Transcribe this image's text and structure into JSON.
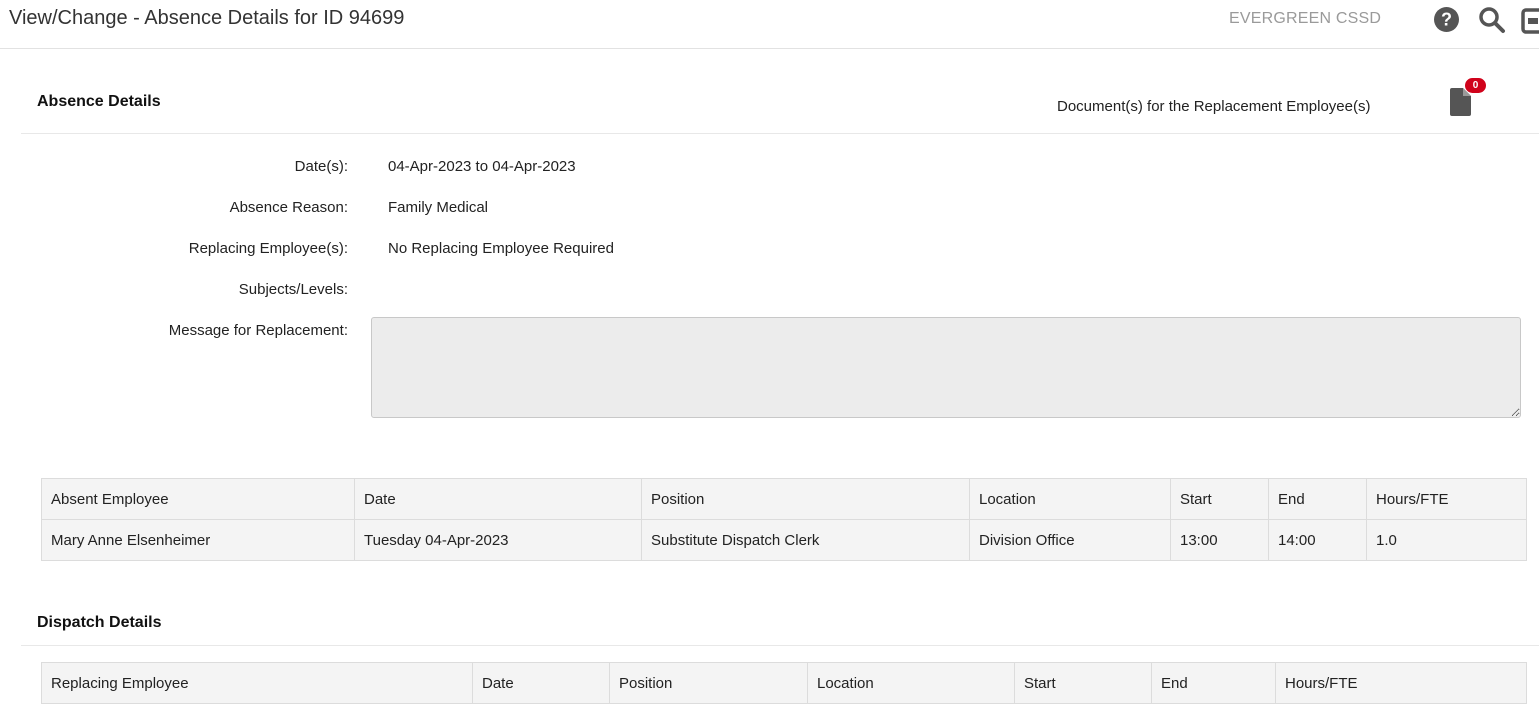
{
  "header": {
    "title": "View/Change - Absence Details for ID 94699",
    "org_name": "EVERGREEN CSSD",
    "icons": [
      "help-icon",
      "search-icon",
      "exit-icon"
    ]
  },
  "absence_details": {
    "title": "Absence Details",
    "documents_label": "Document(s) for the Replacement Employee(s)",
    "documents_count": "0",
    "fields": {
      "dates_label": "Date(s):",
      "dates_value": "04-Apr-2023 to 04-Apr-2023",
      "reason_label": "Absence Reason:",
      "reason_value": "Family Medical",
      "replacing_label": "Replacing Employee(s):",
      "replacing_value": "No Replacing Employee Required",
      "subjects_label": "Subjects/Levels:",
      "subjects_value": "",
      "message_label": "Message for Replacement:",
      "message_value": ""
    }
  },
  "absence_table": {
    "columns": [
      "Absent Employee",
      "Date",
      "Position",
      "Location",
      "Start",
      "End",
      "Hours/FTE"
    ],
    "rows": [
      [
        "Mary Anne Elsenheimer",
        "Tuesday 04-Apr-2023",
        "Substitute Dispatch Clerk",
        "Division Office",
        "13:00",
        "14:00",
        "1.0"
      ]
    ]
  },
  "dispatch_details": {
    "title": "Dispatch Details",
    "columns": [
      "Replacing Employee",
      "Date",
      "Position",
      "Location",
      "Start",
      "End",
      "Hours/FTE"
    ]
  },
  "colors": {
    "badge": "#d0021b",
    "icon": "#555555",
    "org_name": "#9a9a9a"
  }
}
